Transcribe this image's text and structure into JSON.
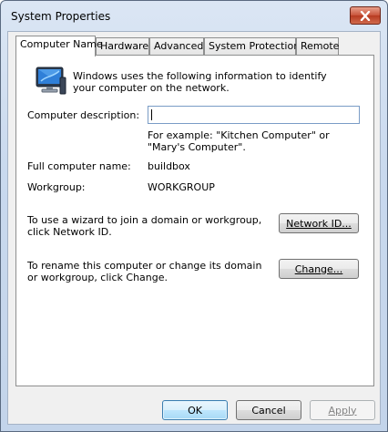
{
  "window": {
    "title": "System Properties"
  },
  "tabs": [
    {
      "label": "Computer Name",
      "active": true
    },
    {
      "label": "Hardware",
      "active": false
    },
    {
      "label": "Advanced",
      "active": false
    },
    {
      "label": "System Protection",
      "active": false
    },
    {
      "label": "Remote",
      "active": false
    }
  ],
  "panel": {
    "intro": "Windows uses the following information to identify your computer on the network.",
    "description_label": "Computer description:",
    "description_value": "",
    "example_text": "For example: \"Kitchen Computer\" or \"Mary's Computer\".",
    "full_name_label": "Full computer name:",
    "full_name_value": "buildbox",
    "workgroup_label": "Workgroup:",
    "workgroup_value": "WORKGROUP",
    "network_text": "To use a wizard to join a domain or workgroup, click Network ID.",
    "network_button": "Network ID...",
    "change_text": "To rename this computer or change its domain or workgroup, click Change.",
    "change_button": "Change..."
  },
  "footer": {
    "ok": "OK",
    "cancel": "Cancel",
    "apply": "Apply"
  },
  "icons": {
    "close": "close-icon",
    "computer": "computer-icon"
  }
}
